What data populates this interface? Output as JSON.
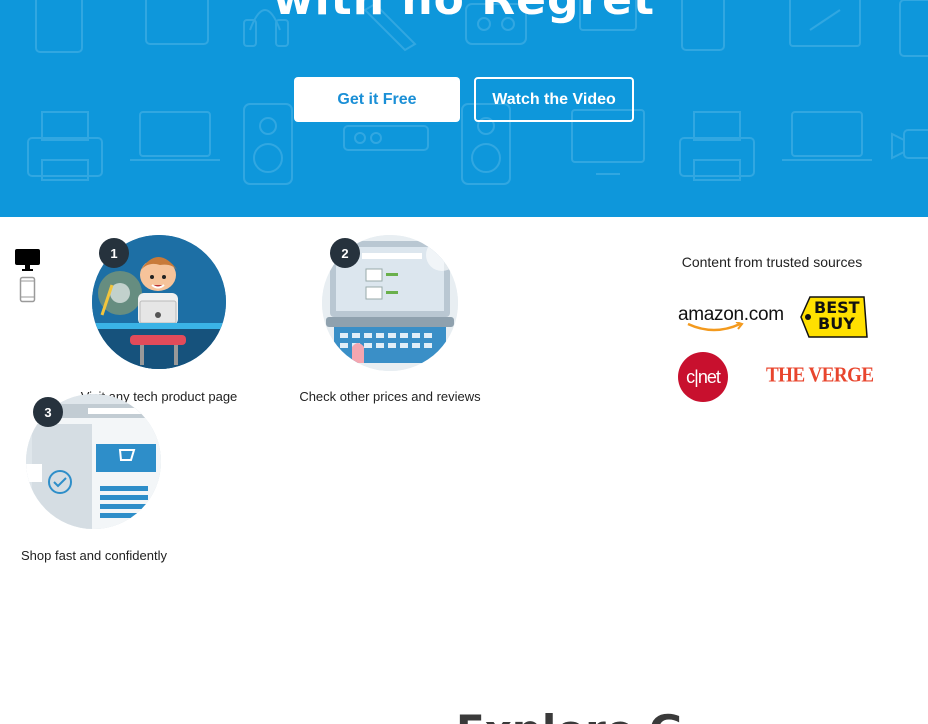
{
  "hero": {
    "title": "with no Regret",
    "get_free_label": "Get it Free",
    "watch_video_label": "Watch the Video",
    "background_color": "#0e97db"
  },
  "device_toggle": {
    "icons": [
      "desktop-icon",
      "mobile-phone-icon"
    ],
    "selected": "desktop"
  },
  "steps": [
    {
      "number": "1",
      "caption": "Visit any tech product page"
    },
    {
      "number": "2",
      "caption": "Check other prices and reviews"
    },
    {
      "number": "3",
      "caption": "Shop fast and confidently"
    }
  ],
  "trusted": {
    "title": "Content from trusted sources",
    "logos": {
      "amazon": "amazon.com",
      "bestbuy_line1": "BEST",
      "bestbuy_line2": "BUY",
      "cnet": "c|net",
      "verge": "THE VERGE"
    }
  },
  "next_section": {
    "title": "Explore G"
  },
  "colors": {
    "accent": "#1a8fd6",
    "badge": "#26323d",
    "bestbuy_yellow": "#ffe000",
    "cnet_red": "#c8102e",
    "verge_red": "#e8452d"
  }
}
